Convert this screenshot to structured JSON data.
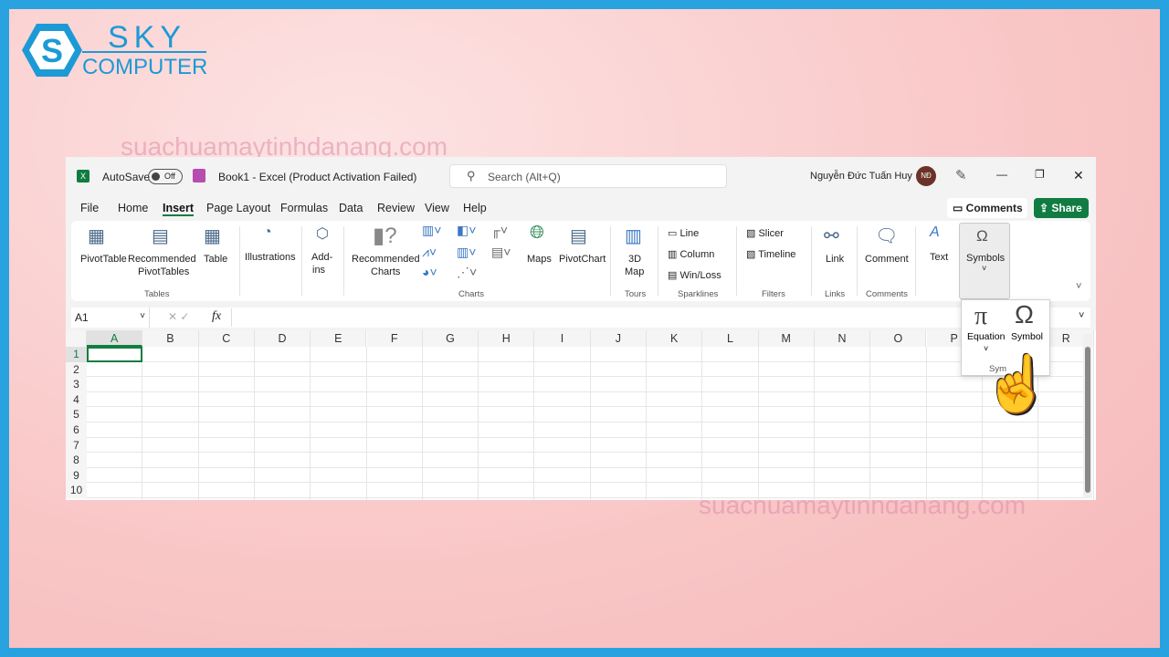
{
  "brand": {
    "sky": "SKY",
    "computer": "COMPUTER",
    "watermark": "suachuamaytinhdanang.com"
  },
  "titlebar": {
    "autosave": "AutoSave",
    "toggle": "Off",
    "title": "Book1  -  Excel (Product Activation Failed)",
    "search_placeholder": "Search (Alt+Q)",
    "user": "Nguyễn Đức Tuấn Huy",
    "initials": "NĐ",
    "minimize": "—",
    "restore": "❐",
    "close": "✕"
  },
  "tabs": [
    "File",
    "Home",
    "Insert",
    "Page Layout",
    "Formulas",
    "Data",
    "Review",
    "View",
    "Help"
  ],
  "active_tab": "Insert",
  "actions": {
    "comments": "Comments",
    "share": "Share"
  },
  "ribbon": {
    "pivottable": "PivotTable",
    "rec_pivot1": "Recommended",
    "rec_pivot2": "PivotTables",
    "table": "Table",
    "illustrations": "Illustrations",
    "addins1": "Add-",
    "addins2": "ins",
    "rec_charts1": "Recommended",
    "rec_charts2": "Charts",
    "maps": "Maps",
    "pivotchart": "PivotChart",
    "map3d1": "3D",
    "map3d2": "Map",
    "line": "Line",
    "column": "Column",
    "winloss": "Win/Loss",
    "slicer": "Slicer",
    "timeline": "Timeline",
    "link": "Link",
    "comment": "Comment",
    "text": "Text",
    "symbols": "Symbols",
    "groups": {
      "tables": "Tables",
      "charts": "Charts",
      "tours": "Tours",
      "sparklines": "Sparklines",
      "filters": "Filters",
      "links": "Links",
      "comments": "Comments"
    }
  },
  "formula": {
    "namebox": "A1",
    "fx": "fx",
    "value": ""
  },
  "columns": [
    "A",
    "B",
    "C",
    "D",
    "E",
    "F",
    "G",
    "H",
    "I",
    "J",
    "K",
    "L",
    "M",
    "N",
    "O",
    "P",
    "",
    "R"
  ],
  "rows": [
    "1",
    "2",
    "3",
    "4",
    "5",
    "6",
    "7",
    "8",
    "9",
    "10"
  ],
  "dropdown": {
    "equation": "Equation",
    "symbol": "Symbol",
    "group": "Sym"
  },
  "colors": {
    "accent": "#107c41",
    "frame": "#29a3e0"
  }
}
